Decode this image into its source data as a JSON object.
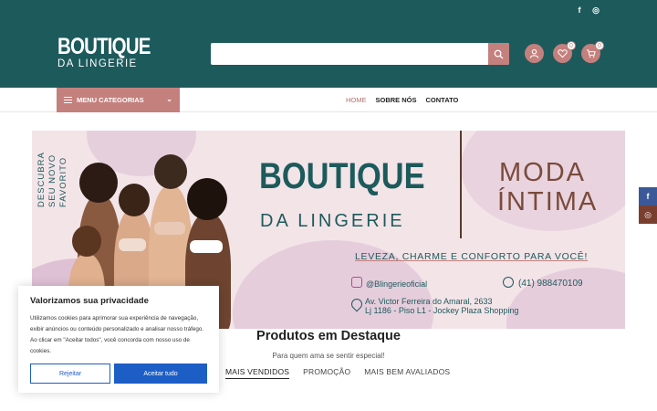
{
  "header": {
    "logo_line1": "BOUTIQUE",
    "logo_line2": "DA LINGERIE",
    "search_placeholder": "",
    "wishlist_count": "0",
    "cart_count": "0",
    "topbar_facebook": "f",
    "topbar_instagram": "◎"
  },
  "nav": {
    "menu_categories": "MENU CATEGORIAS",
    "links": [
      "HOME",
      "SOBRE NÓS",
      "CONTATO"
    ]
  },
  "banner": {
    "vertical_lines": [
      "DESCUBRA",
      "SEU NOVO",
      "FAVORITO"
    ],
    "brand_line1": "BOUTIQUE",
    "brand_line2": "DA LINGERIE",
    "moda_line1": "MODA",
    "moda_line2": "ÍNTIMA",
    "tagline": "LEVEZA, CHARME E CONFORTO PARA VOCÊ!",
    "instagram": "@Blingerieoficial",
    "whatsapp": "(41) 988470109",
    "address_line1": "Av. Victor Ferreira do Amaral, 2633",
    "address_line2": "Lj 1186 - Piso L1 - Jockey Plaza Shopping"
  },
  "products": {
    "title": "Produtos em Destaque",
    "subtitle": "Para quem ama se sentir especial!",
    "tabs": [
      "MAIS VENDIDOS",
      "PROMOÇÃO",
      "MAIS BEM AVALIADOS"
    ]
  },
  "cookie": {
    "title": "Valorizamos sua privacidade",
    "text": "Utilizamos cookies para aprimorar sua experiência de navegação, exibir anúncios ou conteúdo personalizado e analisar nosso tráfego. Ao clicar em \"Aceitar todos\", você concorda com nosso uso de cookies.",
    "reject": "Rejeitar",
    "accept": "Aceitar tudo"
  },
  "side_social": {
    "facebook": "f",
    "instagram": "◎"
  },
  "colors": {
    "primary": "#1d5a5c",
    "accent": "#c4807d",
    "button_blue": "#1d5ec6"
  }
}
